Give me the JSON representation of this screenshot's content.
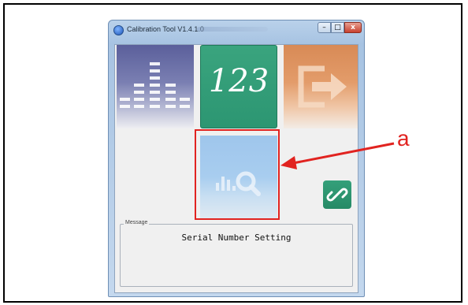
{
  "window": {
    "title": "Calibration Tool V1.4.1.0",
    "controls": {
      "minimize": "–",
      "maximize": "□",
      "close": "x"
    }
  },
  "tiles": {
    "number_label": "123"
  },
  "message": {
    "legend": "Message",
    "text": "Serial Number Setting"
  },
  "annotation": {
    "label": "a",
    "color": "#e12320"
  },
  "colors": {
    "tile_green": "#2c9672",
    "tile_orange": "#e39c6a",
    "tile_purple": "#6a6ea7",
    "tile_blue": "#a8cdef"
  }
}
